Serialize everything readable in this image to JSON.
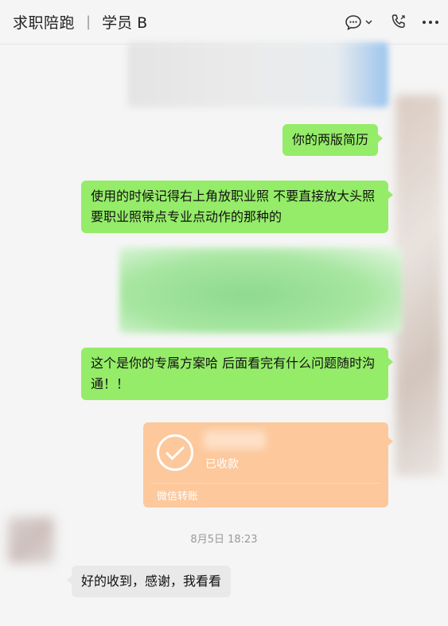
{
  "header": {
    "title": "求职陪跑",
    "separator": "|",
    "subtitle": "学员 B"
  },
  "messages": [
    {
      "id": "m1",
      "text": "你的两版简历"
    },
    {
      "id": "m2",
      "text": "使用的时候记得右上角放职业照 不要直接放大头照 要职业照带点专业点动作的那种的"
    },
    {
      "id": "m3",
      "text": "这个是你的专属方案哈 后面看完有什么问题随时沟通！！"
    },
    {
      "id": "m5",
      "text": "好的收到，感谢，我看看"
    }
  ],
  "transfer": {
    "status": "已收款",
    "footer": "微信转账"
  },
  "timestamp": "8月5日 18:23",
  "colors": {
    "bubble_green": "#95ec69",
    "bubble_gray": "#e9e9e9",
    "transfer": "#fcc89c",
    "accent": "#07c160"
  },
  "icons": [
    "chat-bubble-icon",
    "chevron-down-icon",
    "phone-icon",
    "more-icon",
    "check-icon"
  ]
}
